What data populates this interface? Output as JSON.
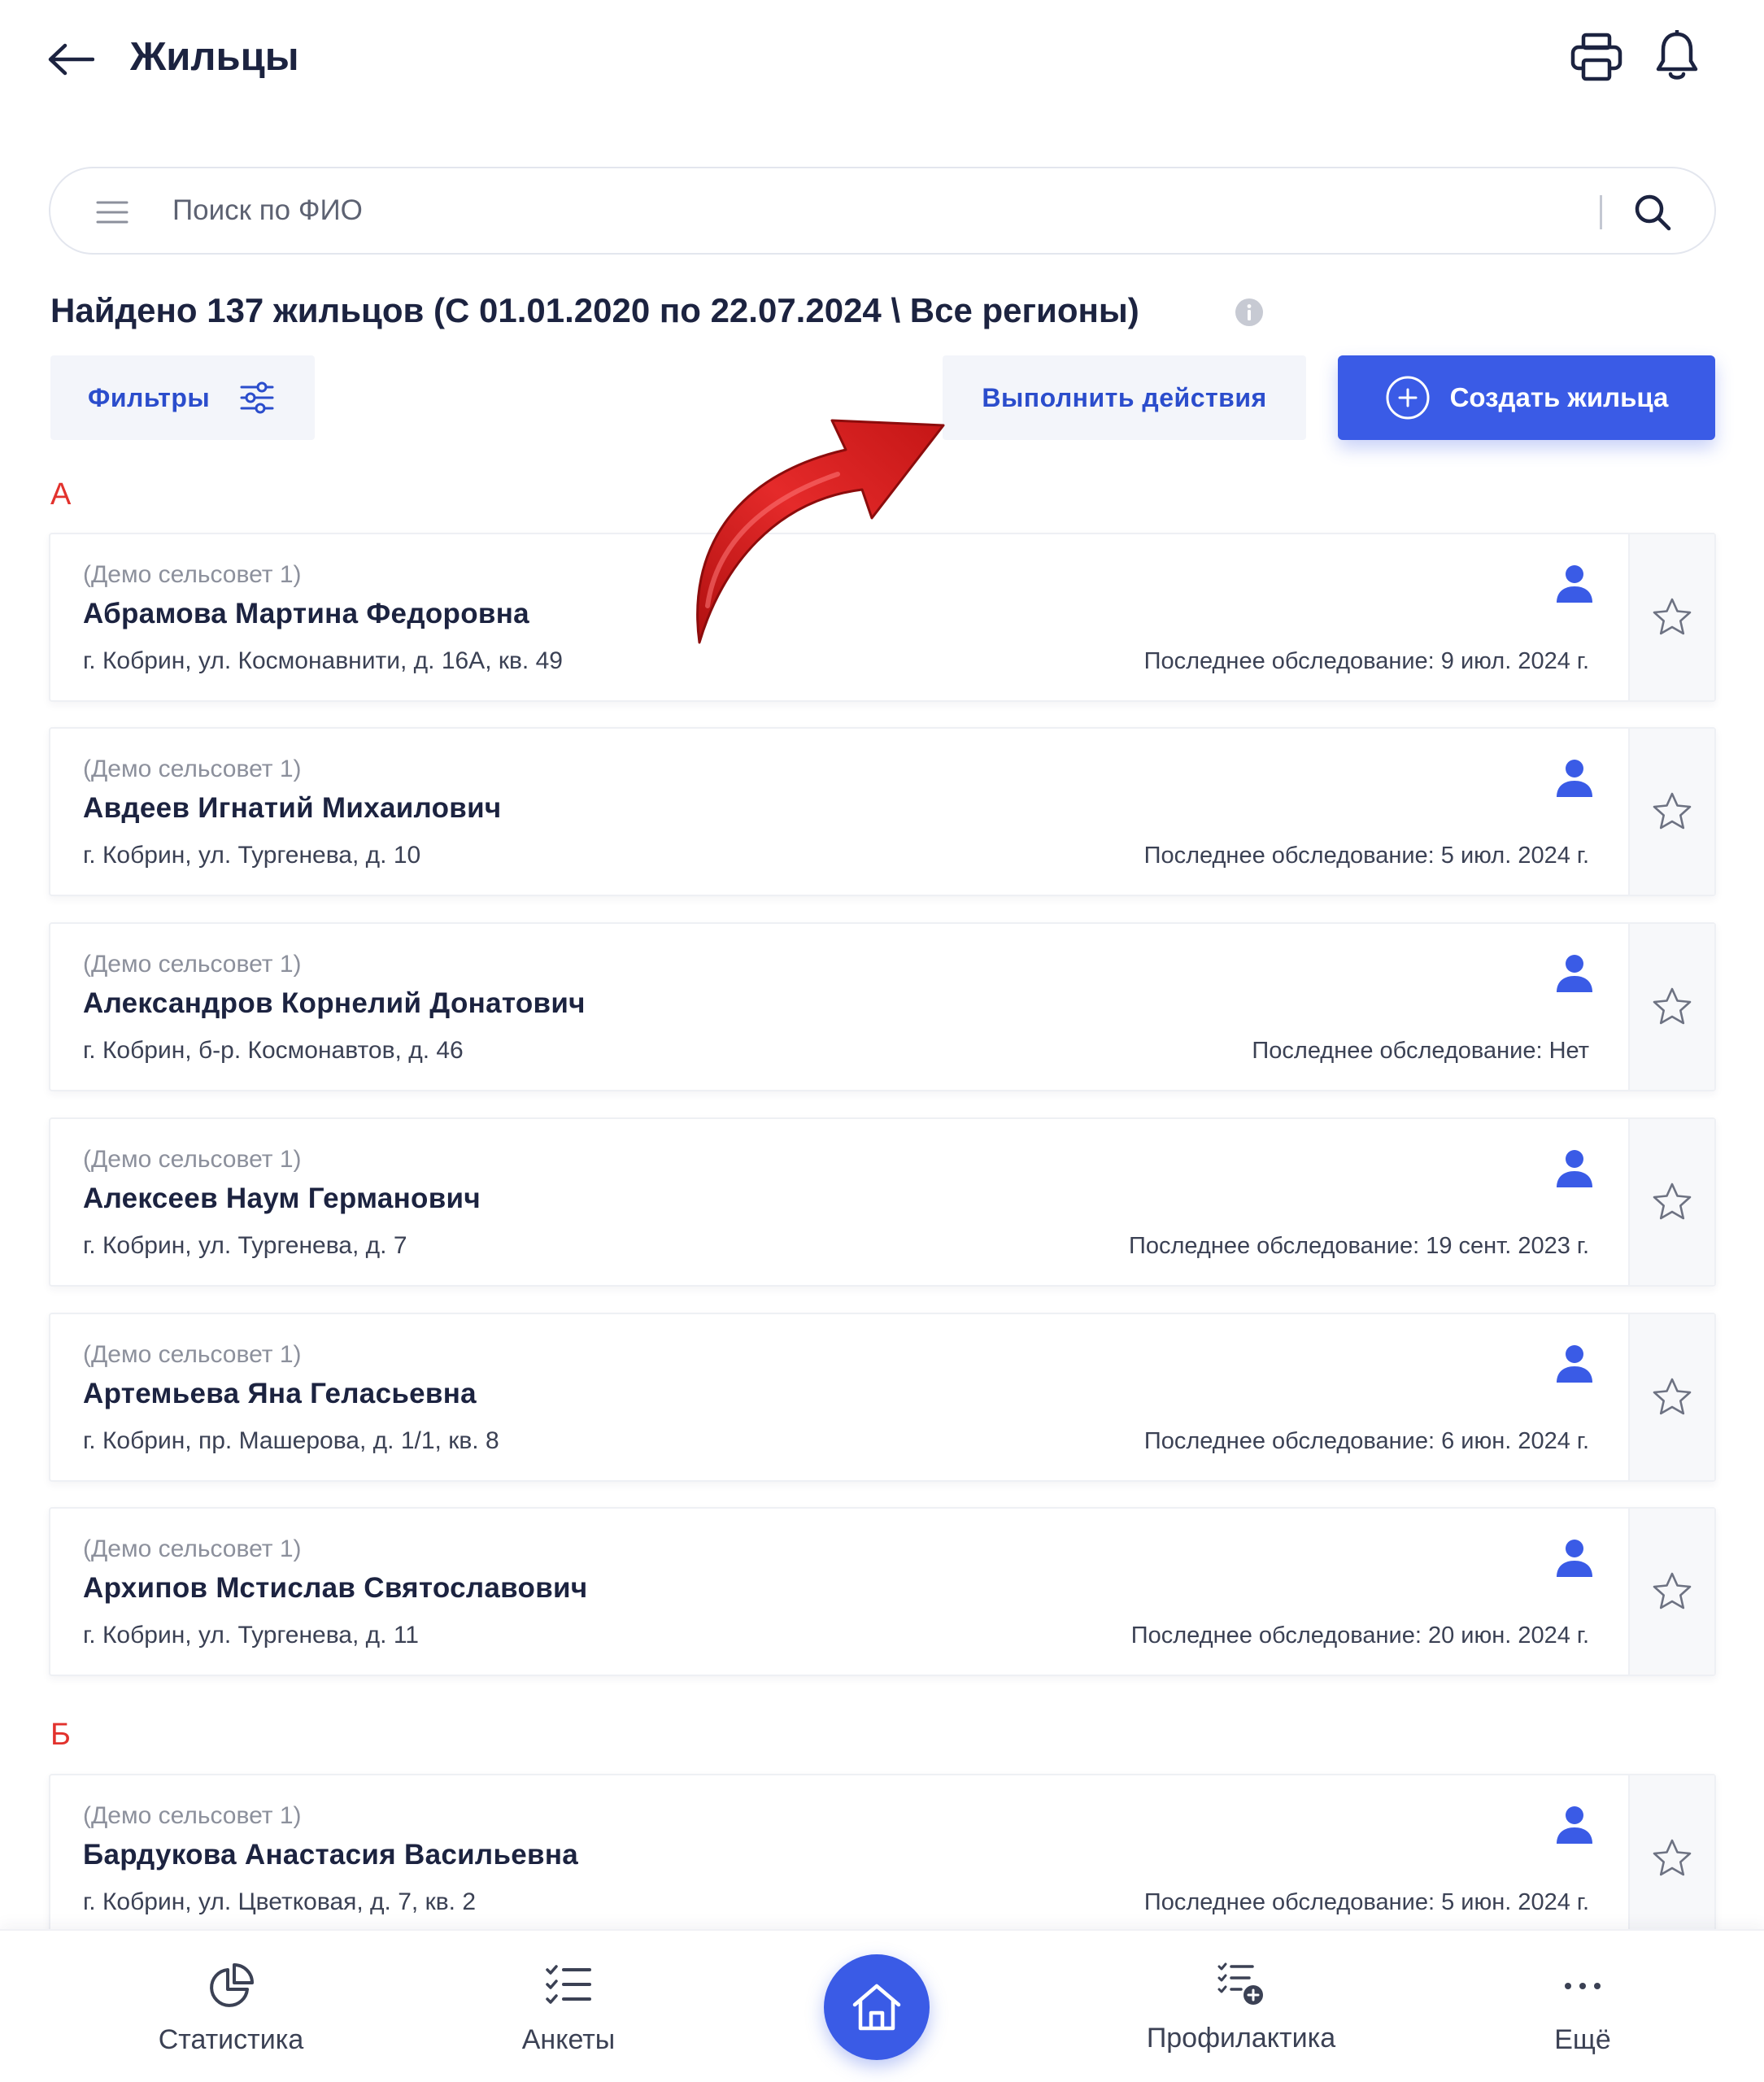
{
  "header": {
    "title": "Жильцы"
  },
  "search": {
    "placeholder": "Поиск по ФИО"
  },
  "summary": {
    "text": "Найдено 137 жильцов (С 01.01.2020 по 22.07.2024 \\ Все регионы)"
  },
  "toolbar": {
    "filters_label": "Фильтры",
    "actions_label": "Выполнить действия",
    "create_label": "Создать жильца"
  },
  "sections": [
    {
      "letter": "А",
      "residents": [
        {
          "region": "(Демо сельсовет 1)",
          "name": "Абрамова Мартина Федоровна",
          "address": "г. Кобрин, ул. Космонавнити, д. 16А, кв. 49",
          "last_exam": "Последнее обследование: 9 июл. 2024 г."
        },
        {
          "region": "(Демо сельсовет 1)",
          "name": "Авдеев Игнатий Михаилович",
          "address": "г. Кобрин, ул. Тургенева, д. 10",
          "last_exam": "Последнее обследование: 5 июл. 2024 г."
        },
        {
          "region": "(Демо сельсовет 1)",
          "name": "Александров Корнелий Донатович",
          "address": "г. Кобрин, б-р. Космонавтов, д. 46",
          "last_exam": "Последнее обследование: Нет"
        },
        {
          "region": "(Демо сельсовет 1)",
          "name": "Алексеев Наум Германович",
          "address": "г. Кобрин, ул. Тургенева, д. 7",
          "last_exam": "Последнее обследование: 19 сент. 2023 г."
        },
        {
          "region": "(Демо сельсовет 1)",
          "name": "Артемьева Яна Геласьевна",
          "address": "г. Кобрин, пр. Машерова, д. 1/1, кв. 8",
          "last_exam": "Последнее обследование: 6 июн. 2024 г."
        },
        {
          "region": "(Демо сельсовет 1)",
          "name": "Архипов Мстислав Святославович",
          "address": "г. Кобрин, ул. Тургенева, д. 11",
          "last_exam": "Последнее обследование: 20 июн. 2024 г."
        }
      ]
    },
    {
      "letter": "Б",
      "residents": [
        {
          "region": "(Демо сельсовет 1)",
          "name": "Бардукова Анастасия Васильевна",
          "address": "г. Кобрин, ул. Цветковая, д. 7, кв. 2",
          "last_exam": "Последнее обследование: 5 июн. 2024 г."
        }
      ]
    }
  ],
  "bottom_nav": {
    "statistics": "Статистика",
    "surveys": "Анкеты",
    "prevention": "Профилактика",
    "more": "Ещё"
  },
  "colors": {
    "accent": "#3a5be6",
    "accent_text": "#2b4dcc",
    "section_letter": "#e2322d",
    "annotation_arrow": "#d42020"
  }
}
